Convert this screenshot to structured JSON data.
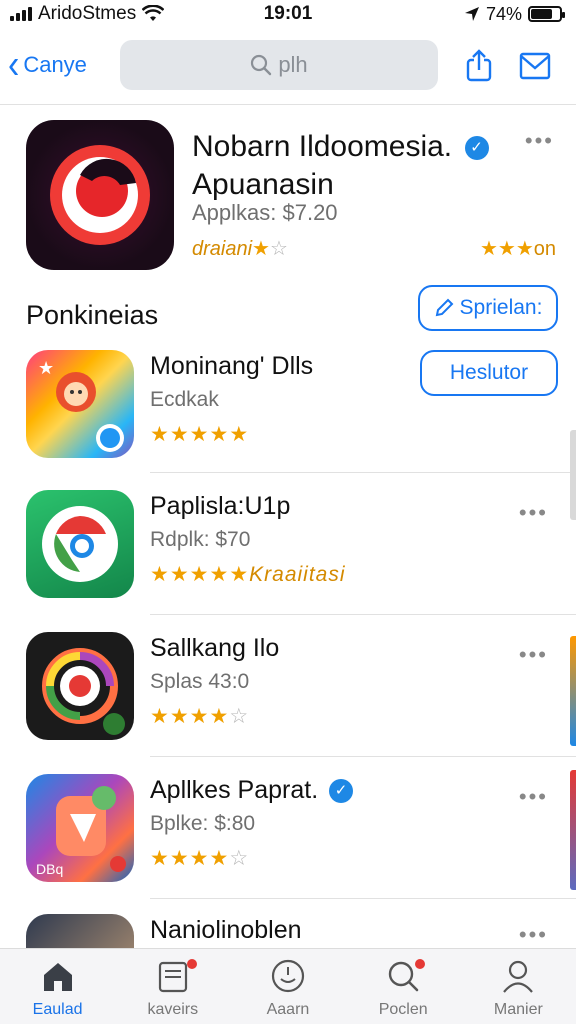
{
  "status_bar": {
    "carrier": "AridoStmes",
    "time": "19:01",
    "battery_percent": "74%",
    "battery_level": 0.74
  },
  "nav": {
    "back_label": "Canye",
    "search_placeholder": "plh",
    "icons": [
      "share-icon",
      "mail-icon"
    ]
  },
  "featured": {
    "title_line1": "Nobarn Ildoomesia.",
    "title_line2": "Apuanasin",
    "price": "Applkas: $7.20",
    "rating_left": "draiani",
    "rating_right": "on"
  },
  "section": {
    "title": "Ponkineias",
    "action_label": "Sprielan:",
    "secondary_label": "Heslutor"
  },
  "apps": [
    {
      "name": "Moninang' Dlls",
      "sub": "Ecdkak",
      "stars": 4.5,
      "rating_text": ""
    },
    {
      "name": "Paplisla:U1p",
      "sub": "Rdplk: $70",
      "stars": 4.5,
      "rating_text": "Kraaiitasi"
    },
    {
      "name": "Sallkang Ilo",
      "sub": "Splas 43:0",
      "stars": 3.5,
      "rating_text": ""
    },
    {
      "name": "Apllkes Paprat.",
      "sub": "Bplke: $:80",
      "stars": 4,
      "rating_text": ""
    },
    {
      "name": "Naniolinoblen",
      "sub": "",
      "stars": 0,
      "rating_text": ""
    }
  ],
  "tabs": [
    {
      "label": "Eaulad",
      "icon": "home-icon",
      "active": true
    },
    {
      "label": "kaveirs",
      "icon": "apps-icon",
      "active": false
    },
    {
      "label": "Aaarn",
      "icon": "games-icon",
      "active": false
    },
    {
      "label": "Poclen",
      "icon": "search-icon",
      "active": false
    },
    {
      "label": "Manier",
      "icon": "profile-icon",
      "active": false
    }
  ],
  "colors": {
    "accent": "#1877f2",
    "star": "#f0a000",
    "verified": "#1e88e5"
  }
}
